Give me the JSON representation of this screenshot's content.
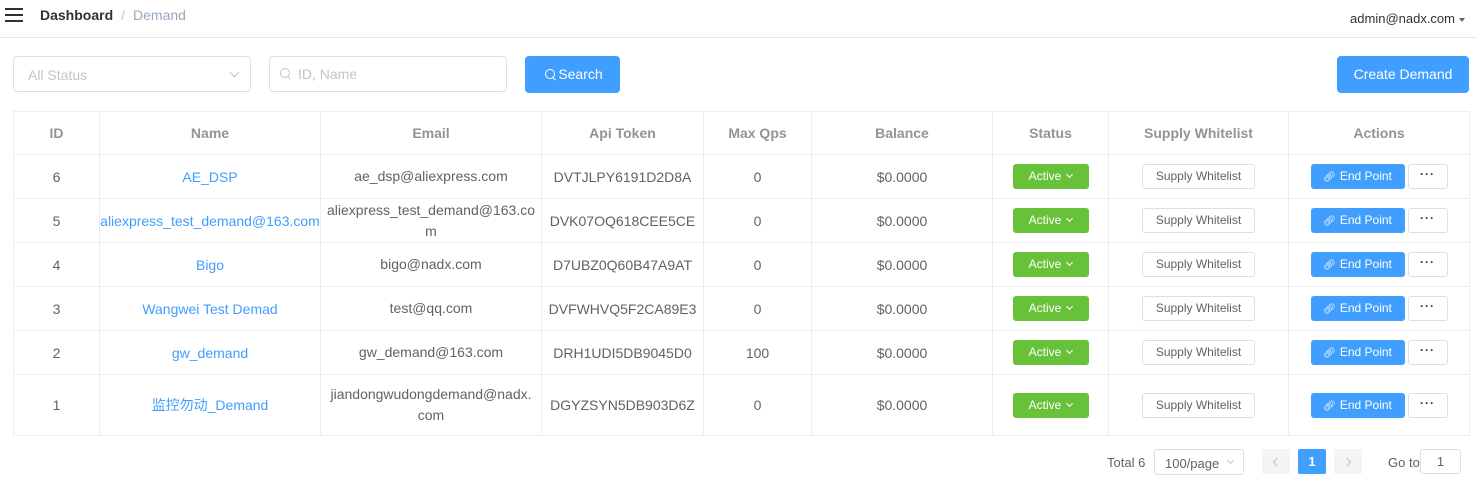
{
  "header": {
    "breadcrumb_home": "Dashboard",
    "breadcrumb_separator": "/",
    "breadcrumb_current": "Demand",
    "user_email": "admin@nadx.com"
  },
  "filters": {
    "status_placeholder": "All Status",
    "search_placeholder": "ID, Name",
    "search_button": "Search",
    "create_button": "Create Demand"
  },
  "table": {
    "columns": [
      "ID",
      "Name",
      "Email",
      "Api Token",
      "Max Qps",
      "Balance",
      "Status",
      "Supply Whitelist",
      "Actions"
    ],
    "rows": [
      {
        "id": "6",
        "name": "AE_DSP",
        "email": "ae_dsp@aliexpress.com",
        "token": "DVTJLPY6191D2D8A",
        "qps": "0",
        "balance": "$0.0000",
        "status": "Active",
        "whitelist": "Supply Whitelist",
        "endpoint": "End Point",
        "more": "···"
      },
      {
        "id": "5",
        "name": "aliexpress_test_demand@163.com",
        "email": "aliexpress_test_demand@163.com",
        "token": "DVK07OQ618CEE5CE",
        "qps": "0",
        "balance": "$0.0000",
        "status": "Active",
        "whitelist": "Supply Whitelist",
        "endpoint": "End Point",
        "more": "···"
      },
      {
        "id": "4",
        "name": "Bigo",
        "email": "bigo@nadx.com",
        "token": "D7UBZ0Q60B47A9AT",
        "qps": "0",
        "balance": "$0.0000",
        "status": "Active",
        "whitelist": "Supply Whitelist",
        "endpoint": "End Point",
        "more": "···"
      },
      {
        "id": "3",
        "name": "Wangwei Test Demad",
        "email": "test@qq.com",
        "token": "DVFWHVQ5F2CA89E3",
        "qps": "0",
        "balance": "$0.0000",
        "status": "Active",
        "whitelist": "Supply Whitelist",
        "endpoint": "End Point",
        "more": "···"
      },
      {
        "id": "2",
        "name": "gw_demand",
        "email": "gw_demand@163.com",
        "token": "DRH1UDI5DB9045D0",
        "qps": "100",
        "balance": "$0.0000",
        "status": "Active",
        "whitelist": "Supply Whitelist",
        "endpoint": "End Point",
        "more": "···"
      },
      {
        "id": "1",
        "name": "监控勿动_Demand",
        "email": "jiandongwudongdemand@nadx.com",
        "token": "DGYZSYN5DB903D6Z",
        "qps": "0",
        "balance": "$0.0000",
        "status": "Active",
        "whitelist": "Supply Whitelist",
        "endpoint": "End Point",
        "more": "···"
      }
    ]
  },
  "pagination": {
    "total": "Total 6",
    "page_size": "100/page",
    "current_page": "1",
    "goto_label": "Go to",
    "goto_value": "1"
  },
  "colors": {
    "primary": "#409eff",
    "success": "#67c23a",
    "border": "#ebeef5"
  }
}
